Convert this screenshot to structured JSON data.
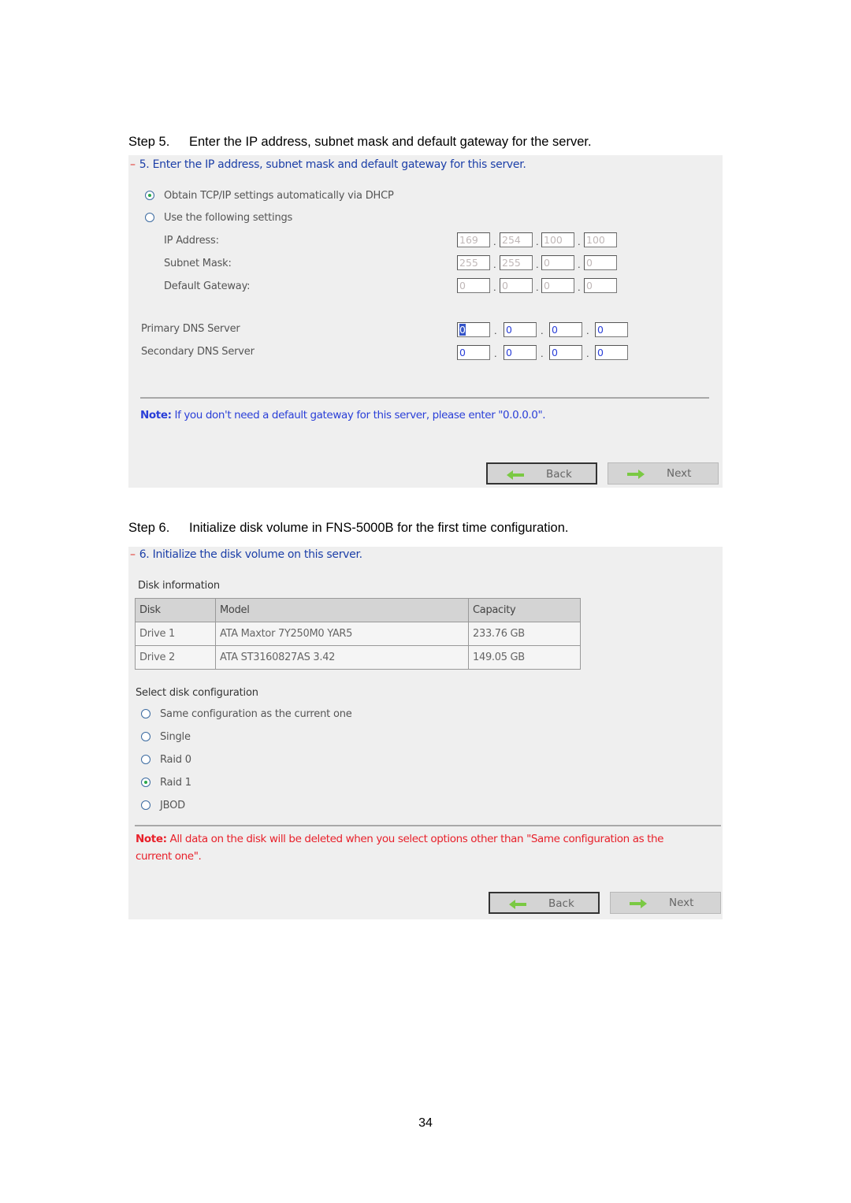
{
  "step5": {
    "caption_num": "Step 5.",
    "caption_text": "Enter the IP address, subnet mask and default gateway for the server.",
    "panel_title": "5. Enter the IP address, subnet mask and default gateway for this server.",
    "radio_dhcp": "Obtain TCP/IP settings automatically via DHCP",
    "radio_manual": "Use the following settings",
    "selected": "dhcp",
    "fields": [
      {
        "label": "IP Address:",
        "octets": [
          "169",
          "254",
          "100",
          "100"
        ]
      },
      {
        "label": "Subnet Mask:",
        "octets": [
          "255",
          "255",
          "0",
          "0"
        ]
      },
      {
        "label": "Default Gateway:",
        "octets": [
          "0",
          "0",
          "0",
          "0"
        ]
      }
    ],
    "dns": [
      {
        "label": "Primary DNS Server",
        "octets": [
          "0",
          "0",
          "0",
          "0"
        ]
      },
      {
        "label": "Secondary DNS Server",
        "octets": [
          "0",
          "0",
          "0",
          "0"
        ]
      }
    ],
    "note_label": "Note:",
    "note_text": "If you don't need a default gateway for this server, please enter \"0.0.0.0\".",
    "back_label": "Back",
    "next_label": "Next"
  },
  "step6": {
    "caption_num": "Step 6.",
    "caption_text": "Initialize disk volume in FNS-5000B for the first time configuration.",
    "panel_title": "6. Initialize the disk volume on this server.",
    "disk_info_label": "Disk information",
    "table": {
      "headers": [
        "Disk",
        "Model",
        "Capacity"
      ],
      "rows": [
        [
          "Drive 1",
          "ATA Maxtor 7Y250M0 YAR5",
          "233.76 GB"
        ],
        [
          "Drive 2",
          "ATA ST3160827AS 3.42",
          "149.05 GB"
        ]
      ]
    },
    "select_label": "Select disk configuration",
    "options": [
      "Same configuration as the current one",
      "Single",
      "Raid 0",
      "Raid 1",
      "JBOD"
    ],
    "selected_option": "Raid 1",
    "note_label": "Note:",
    "note_line1": "All data on the disk will be deleted when you select options other than \"Same configuration as the",
    "note_line2": "current one\".",
    "back_label": "Back",
    "next_label": "Next"
  },
  "colors": {
    "title_blue": "#1c3fa8",
    "note_blue": "#2a3fd8",
    "note_red": "#e8202a",
    "arrow_green": "#7ac943",
    "panel_bg": "#efefef"
  },
  "page_number": "34"
}
